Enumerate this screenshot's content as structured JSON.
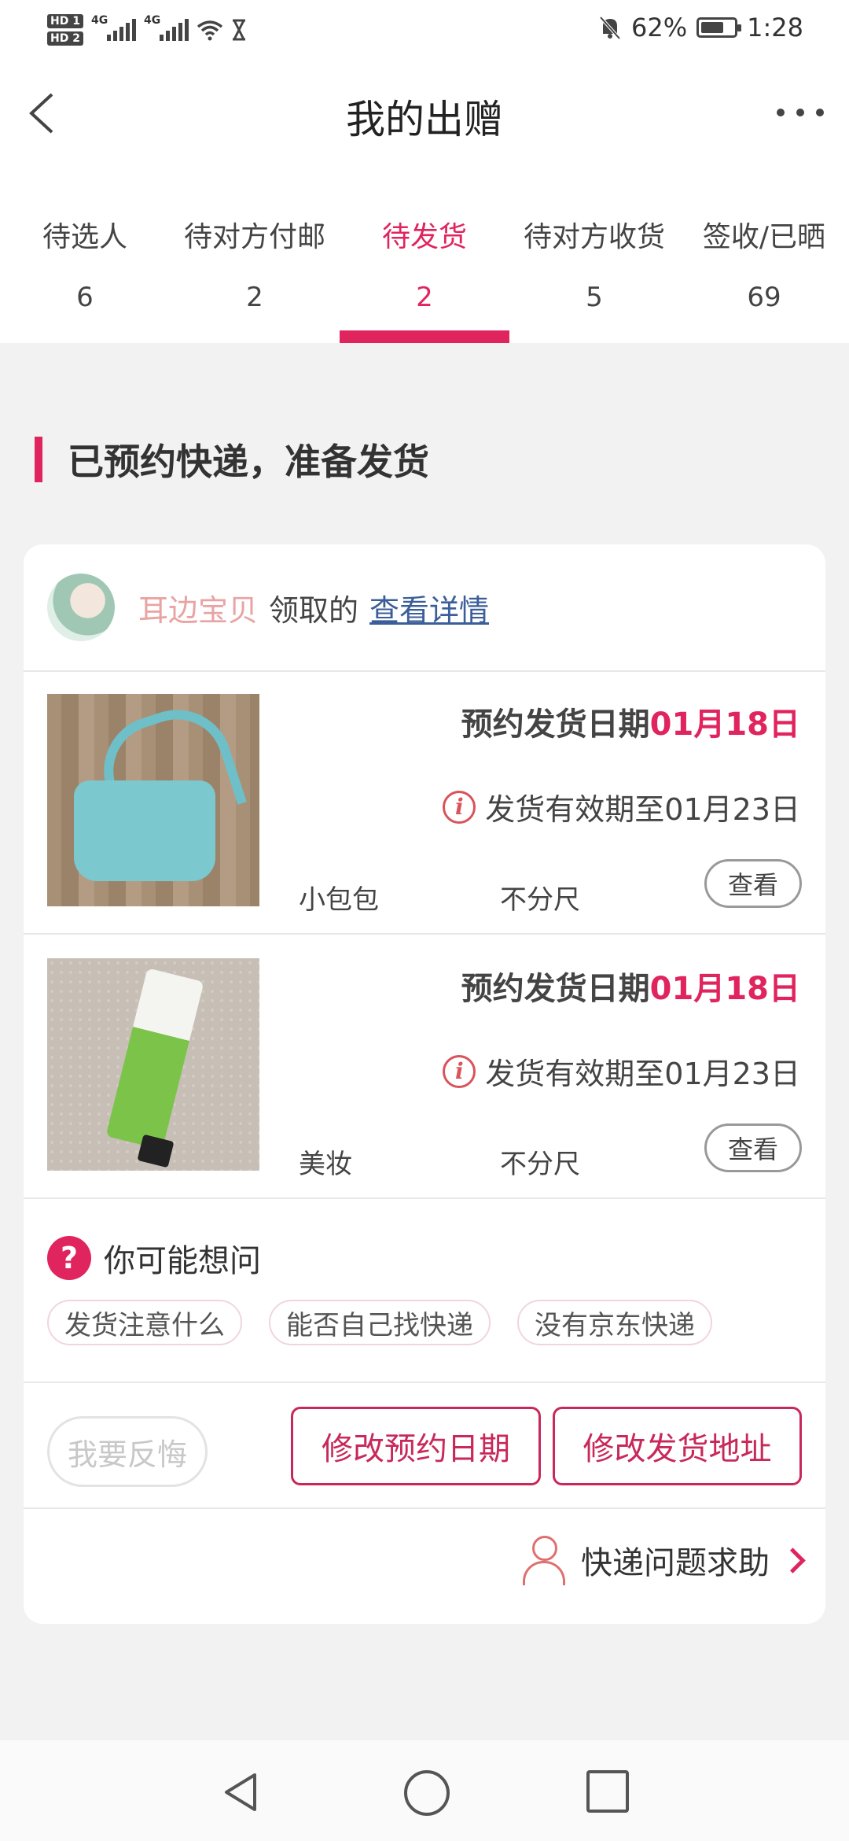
{
  "status_bar": {
    "hd1": "HD 1",
    "hd2": "HD 2",
    "net1": "4G",
    "net2": "4G",
    "battery": "62%",
    "time": "1:28"
  },
  "header": {
    "title": "我的出赠"
  },
  "tabs": [
    {
      "label": "待选人",
      "count": "6"
    },
    {
      "label": "待对方付邮",
      "count": "2"
    },
    {
      "label": "待发货",
      "count": "2"
    },
    {
      "label": "待对方收货",
      "count": "5"
    },
    {
      "label": "签收/已晒",
      "count": "69"
    }
  ],
  "section": {
    "title": "已预约快递，准备发货"
  },
  "giver": {
    "name": "耳边宝贝",
    "action": "领取的",
    "detail_link": "查看详情"
  },
  "items": [
    {
      "date_prefix": "预约发货日期",
      "date": "01月18日",
      "validity": "发货有效期至01月23日",
      "category": "小包包",
      "size": "不分尺",
      "view_label": "查看"
    },
    {
      "date_prefix": "预约发货日期",
      "date": "01月18日",
      "validity": "发货有效期至01月23日",
      "category": "美妆",
      "size": "不分尺",
      "view_label": "查看"
    }
  ],
  "faq": {
    "title": "你可能想问",
    "chips": [
      "发货注意什么",
      "能否自己找快递",
      "没有京东快递"
    ]
  },
  "actions": {
    "regret": "我要反悔",
    "modify_date": "修改预约日期",
    "modify_address": "修改发货地址"
  },
  "help": {
    "label": "快递问题求助"
  },
  "colors": {
    "accent": "#e0245e",
    "button_border": "#c8285a",
    "link": "#3b5e9a"
  }
}
